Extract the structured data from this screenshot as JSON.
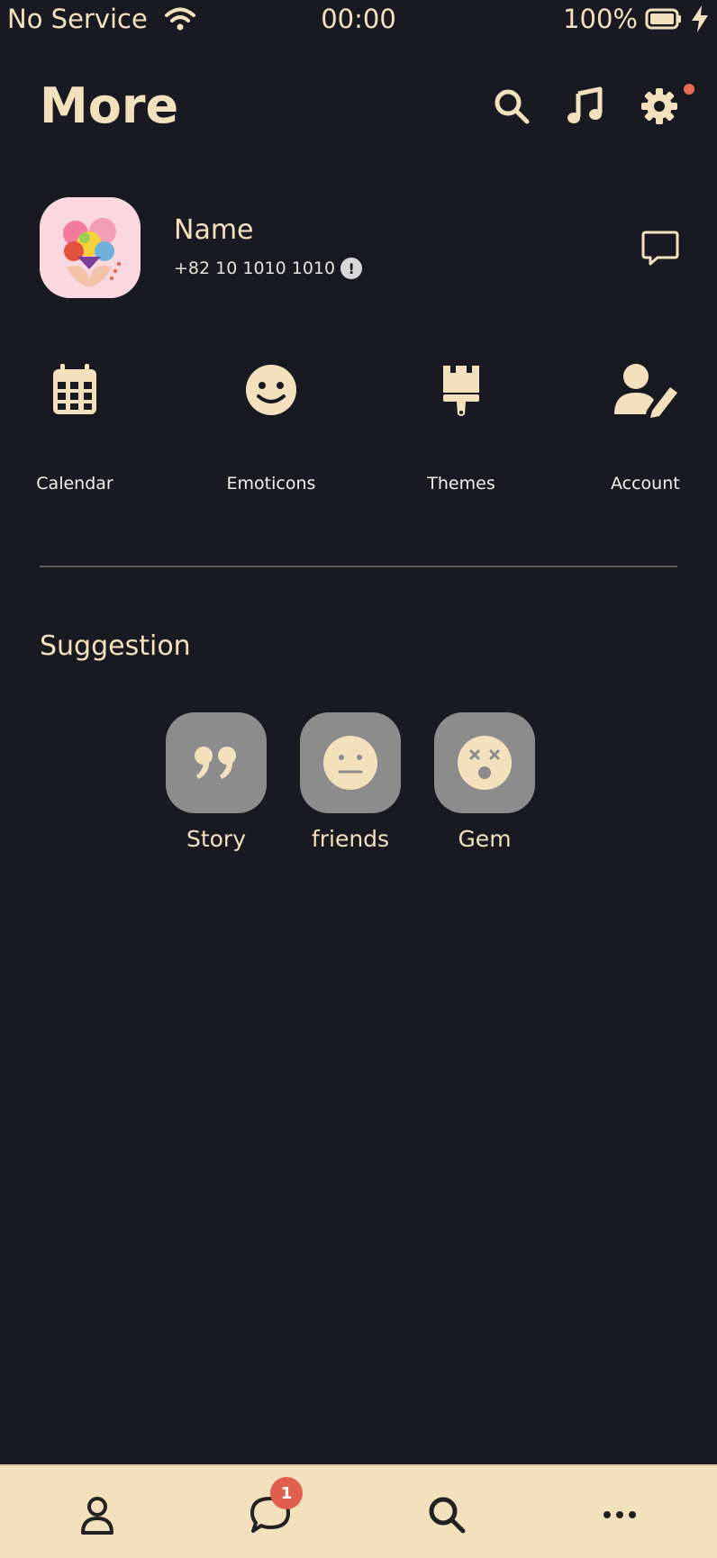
{
  "status_bar": {
    "carrier": "No Service",
    "time": "00:00",
    "battery": "100%",
    "icons": [
      "wifi-icon",
      "battery-icon",
      "charging-bolt-icon"
    ]
  },
  "header": {
    "title": "More",
    "icons": [
      "search-icon",
      "music-note-icon",
      "gear-icon"
    ],
    "settings_has_notification": true
  },
  "profile": {
    "name": "Name",
    "phone": "+82 10 1010 1010",
    "info_badge": "!",
    "icons": [
      "avatar-image",
      "info-icon",
      "chat-bubble-icon"
    ]
  },
  "quick_actions": [
    {
      "label": "Calendar",
      "icon": "calendar-icon"
    },
    {
      "label": "Emoticons",
      "icon": "smiley-icon"
    },
    {
      "label": "Themes",
      "icon": "paintbrush-icon"
    },
    {
      "label": "Account",
      "icon": "user-edit-icon"
    }
  ],
  "suggestion": {
    "title": "Suggestion",
    "items": [
      {
        "label": "Story",
        "icon": "quote-icon"
      },
      {
        "label": "friends",
        "icon": "neutral-face-icon"
      },
      {
        "label": "Gem",
        "icon": "dizzy-face-icon"
      }
    ]
  },
  "tab_bar": {
    "tabs": [
      {
        "icon": "person-icon"
      },
      {
        "icon": "chat-icon",
        "badge": "1"
      },
      {
        "icon": "search-icon"
      },
      {
        "icon": "more-dots-icon"
      }
    ]
  },
  "colors": {
    "background": "#191a21",
    "accent": "#f3e1be",
    "tile": "#8c8c8c",
    "badge": "#e05f4e"
  }
}
